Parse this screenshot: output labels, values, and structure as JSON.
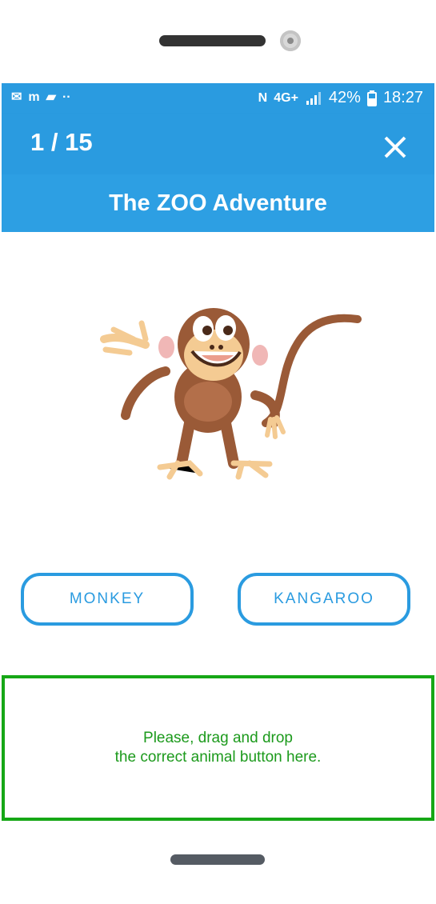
{
  "status_bar": {
    "left_icons": [
      "gmail-icon",
      "bank-app-icon",
      "message-icon",
      "more-notifications-icon"
    ],
    "network": "4G+",
    "battery": "42%",
    "time": "18:27"
  },
  "header": {
    "progress": "1 / 15",
    "close_icon": "close-icon",
    "title": "The ZOO Adventure"
  },
  "colors": {
    "primary": "#2a9be0",
    "dropzone_border": "#16a716",
    "dropzone_text": "#1c9a1c"
  },
  "quiz": {
    "image": "monkey-illustration",
    "choices": [
      "MONKEY",
      "KANGAROO"
    ],
    "dropzone_line1": "Please, drag and drop",
    "dropzone_line2": "the correct animal button here."
  }
}
